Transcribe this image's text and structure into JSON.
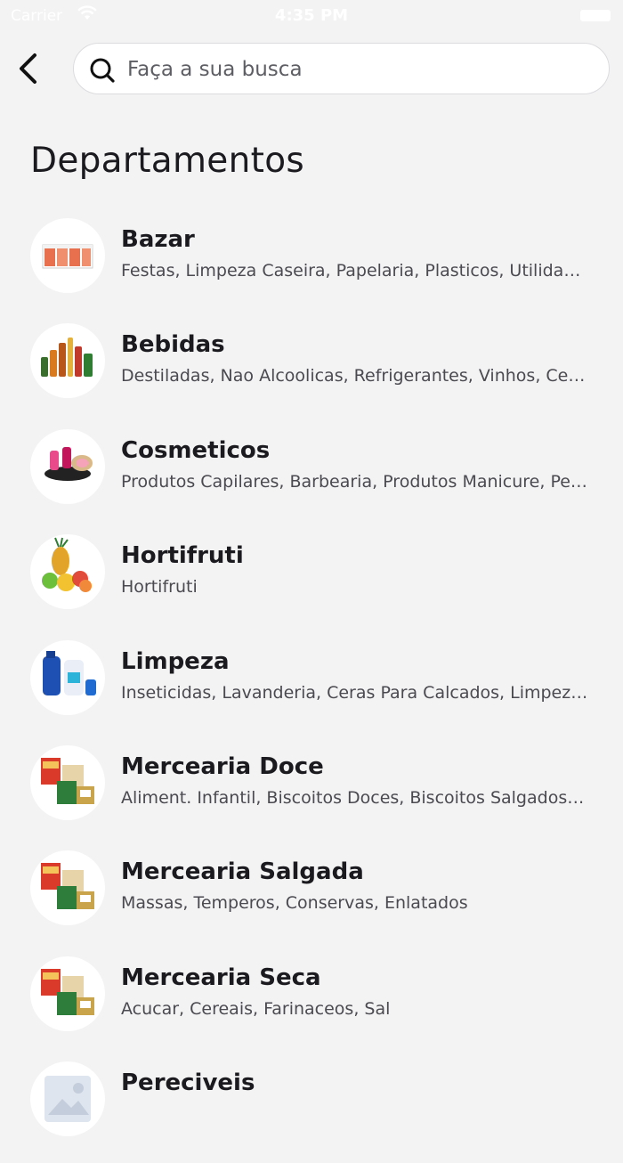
{
  "status_bar": {
    "carrier": "Carrier",
    "time": "4:35 PM"
  },
  "search": {
    "placeholder": "Faça a sua busca",
    "value": ""
  },
  "page_title": "Departamentos",
  "departments": [
    {
      "name": "Bazar",
      "subtitle": "Festas, Limpeza Caseira, Papelaria, Plasticos, Utilidades",
      "icon": "bazar-icon"
    },
    {
      "name": "Bebidas",
      "subtitle": "Destiladas, Nao Alcoolicas, Refrigerantes, Vinhos, Cervejas",
      "icon": "bebidas-icon"
    },
    {
      "name": "Cosmeticos",
      "subtitle": "Produtos Capilares, Barbearia, Produtos Manicure, Perfumaria",
      "icon": "cosmeticos-icon"
    },
    {
      "name": "Hortifruti",
      "subtitle": "Hortifruti",
      "icon": "hortifruti-icon"
    },
    {
      "name": "Limpeza",
      "subtitle": "Inseticidas, Lavanderia, Ceras Para Calcados, Limpeza Geral",
      "icon": "limpeza-icon"
    },
    {
      "name": "Mercearia Doce",
      "subtitle": "Aliment. Infantil, Biscoitos Doces, Biscoitos Salgados, Doces",
      "icon": "mercearia-icon"
    },
    {
      "name": "Mercearia Salgada",
      "subtitle": "Massas, Temperos, Conservas, Enlatados",
      "icon": "mercearia-icon"
    },
    {
      "name": "Mercearia Seca",
      "subtitle": "Acucar, Cereais, Farinaceos, Sal",
      "icon": "mercearia-icon"
    },
    {
      "name": "Pereciveis",
      "subtitle": "",
      "icon": "image-placeholder-icon"
    }
  ]
}
